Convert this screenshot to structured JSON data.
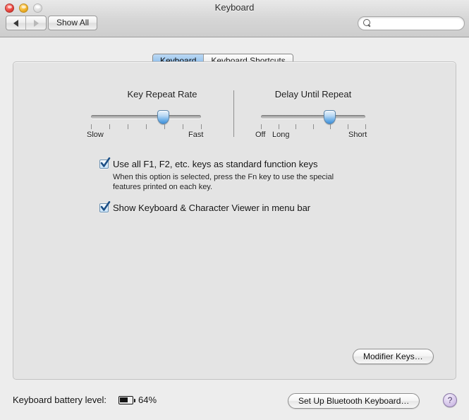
{
  "window": {
    "title": "Keyboard",
    "traffic_lights": [
      "close",
      "minimize",
      "zoom"
    ]
  },
  "toolbar": {
    "back_icon": "triangle-left-icon",
    "forward_icon": "triangle-right-icon",
    "show_all_label": "Show All",
    "search": {
      "value": "",
      "placeholder": "",
      "icon": "search-icon"
    }
  },
  "tabs": [
    {
      "label": "Keyboard",
      "selected": true
    },
    {
      "label": "Keyboard Shortcuts",
      "selected": false
    }
  ],
  "sliders": [
    {
      "title": "Key Repeat Rate",
      "left_label": "Slow",
      "right_label": "Fast",
      "extra_label": "",
      "ticks": 7,
      "value_index": 4
    },
    {
      "title": "Delay Until Repeat",
      "left_label": "Off",
      "extra_label": "Long",
      "right_label": "Short",
      "ticks": 7,
      "value_index": 4
    }
  ],
  "checkboxes": [
    {
      "label": "Use all F1, F2, etc. keys as standard function keys",
      "checked": true,
      "help_line_1": "When this option is selected, press the Fn key to use the special",
      "help_line_2": "features printed on each key."
    },
    {
      "label": "Show Keyboard & Character Viewer in menu bar",
      "checked": true
    }
  ],
  "buttons": {
    "modifier_keys": "Modifier Keys…",
    "setup_bluetooth": "Set Up Bluetooth Keyboard…",
    "help": "?"
  },
  "battery": {
    "label": "Keyboard battery level:",
    "percent_text": "64%",
    "percent_value": 64
  },
  "colors": {
    "window_bg": "#ededed",
    "panel_bg": "#e4e4e4",
    "tab_active": "#9cc6ee",
    "slider_thumb": "#6fb0e8",
    "checkbox_border": "#6e93b3",
    "help_button": "#c1abdd"
  }
}
